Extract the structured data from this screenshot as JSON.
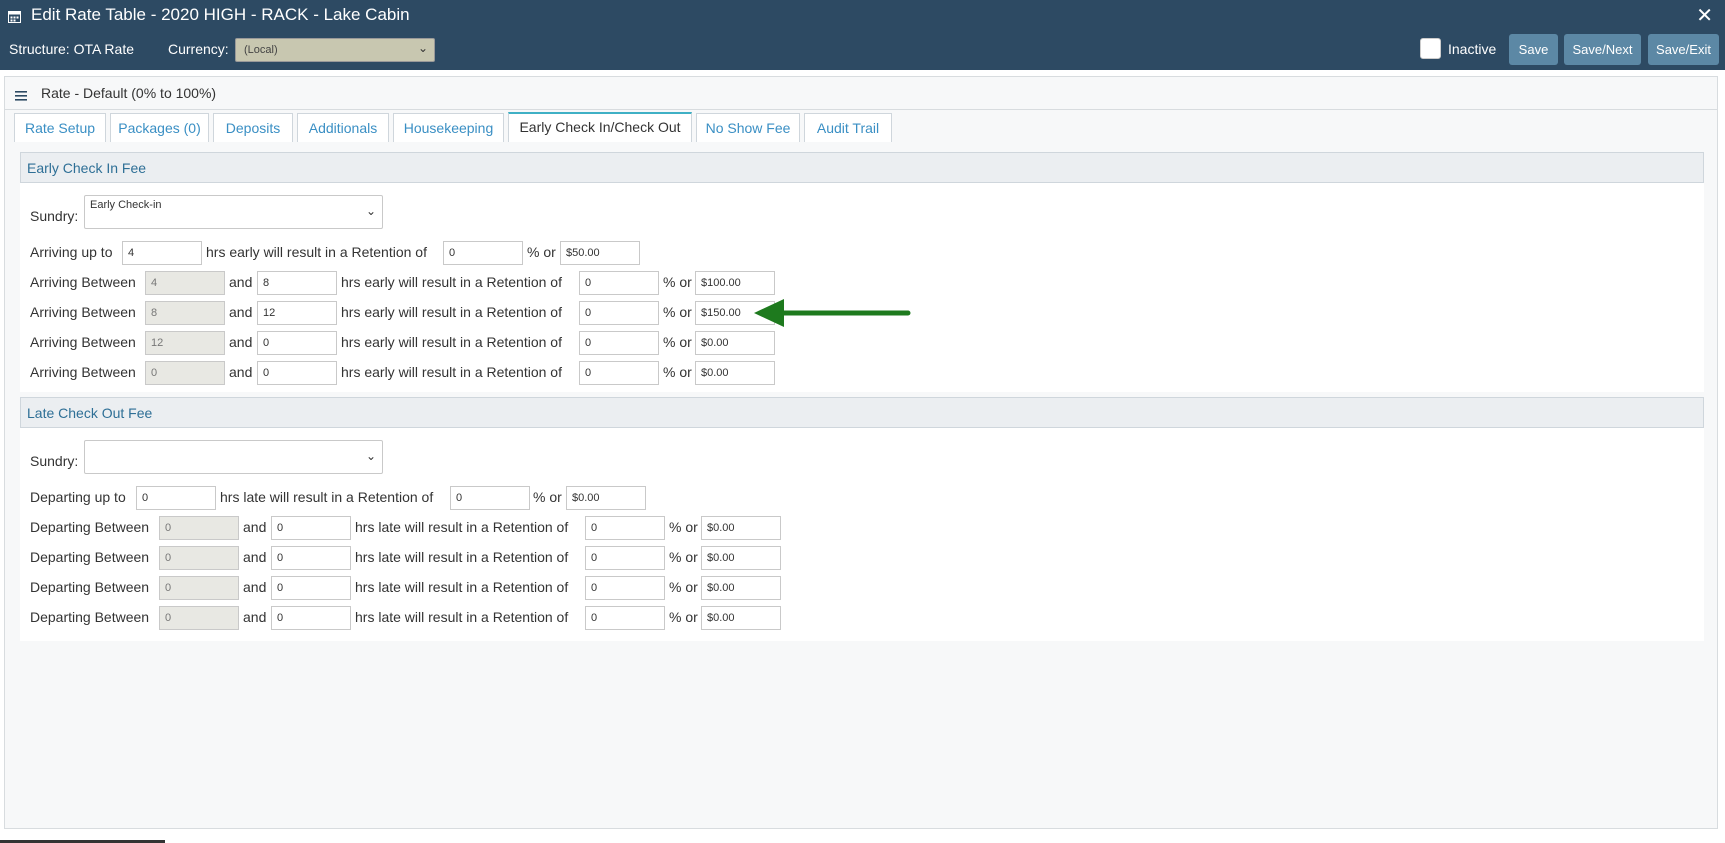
{
  "window": {
    "title": "Edit Rate Table - 2020 HIGH - RACK - Lake Cabin",
    "close_glyph": "✕"
  },
  "toolbar": {
    "structure_label": "Structure: OTA Rate",
    "currency_label": "Currency:",
    "currency_value": "(Local)",
    "inactive_label": "Inactive",
    "inactive_checked": false,
    "save_label": "Save",
    "save_next_label": "Save/Next",
    "save_exit_label": "Save/Exit"
  },
  "panel": {
    "title": "Rate - Default (0% to 100%)"
  },
  "tabs": [
    {
      "label": "Rate Setup"
    },
    {
      "label": "Packages (0)"
    },
    {
      "label": "Deposits"
    },
    {
      "label": "Additionals"
    },
    {
      "label": "Housekeeping"
    },
    {
      "label": "Early Check In/Check Out",
      "active": true
    },
    {
      "label": "No Show Fee"
    },
    {
      "label": "Audit Trail"
    }
  ],
  "early": {
    "title": "Early Check In Fee",
    "sundry_label": "Sundry:",
    "sundry_value": "Early Check-in",
    "first": {
      "pre": "Arriving up to",
      "hours": "4",
      "mid": "hrs early will result in a Retention of",
      "pct": "0",
      "pct_sep": "% or",
      "amount": "$50.00"
    },
    "between_label": "Arriving Between",
    "and_label": "and",
    "mid_text": "hrs early will result in a Retention of",
    "pct_sep": "% or",
    "rows": [
      {
        "from": "4",
        "to": "8",
        "pct": "0",
        "amount": "$100.00"
      },
      {
        "from": "8",
        "to": "12",
        "pct": "0",
        "amount": "$150.00"
      },
      {
        "from": "12",
        "to": "0",
        "pct": "0",
        "amount": "$0.00"
      },
      {
        "from": "0",
        "to": "0",
        "pct": "0",
        "amount": "$0.00"
      }
    ]
  },
  "late": {
    "title": "Late Check Out Fee",
    "sundry_label": "Sundry:",
    "sundry_value": "",
    "first": {
      "pre": "Departing up to",
      "hours": "0",
      "mid": "hrs late will result in a Retention of",
      "pct": "0",
      "pct_sep": "% or",
      "amount": "$0.00"
    },
    "between_label": "Departing Between",
    "and_label": "and",
    "mid_text": "hrs late will result in a Retention of",
    "pct_sep": "% or",
    "rows": [
      {
        "from": "0",
        "to": "0",
        "pct": "0",
        "amount": "$0.00"
      },
      {
        "from": "0",
        "to": "0",
        "pct": "0",
        "amount": "$0.00"
      },
      {
        "from": "0",
        "to": "0",
        "pct": "0",
        "amount": "$0.00"
      },
      {
        "from": "0",
        "to": "0",
        "pct": "0",
        "amount": "$0.00"
      }
    ]
  },
  "colors": {
    "titlebar": "#2d4a63",
    "button": "#5c88a5",
    "tab_link": "#3a8fc4",
    "section_title": "#2e6f96",
    "arrow": "#1e7a1e"
  },
  "annotation": {
    "icon": "green-arrow-icon"
  }
}
